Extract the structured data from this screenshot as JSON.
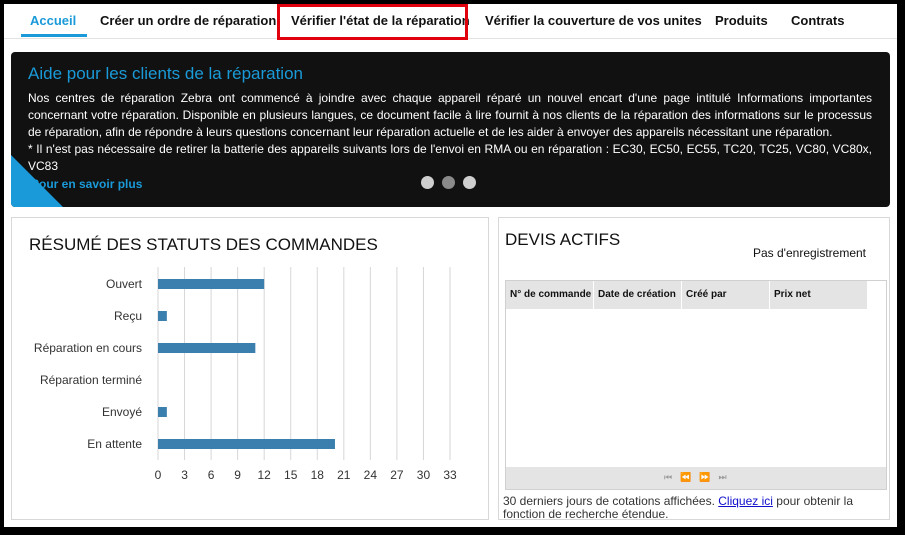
{
  "nav": {
    "items": [
      {
        "label": "Accueil",
        "active": true
      },
      {
        "label": "Créer un ordre de réparation",
        "active": false
      },
      {
        "label": "Vérifier l'état de la réparation",
        "active": false
      },
      {
        "label": "Vérifier la couverture de vos unites",
        "active": false
      },
      {
        "label": "Produits",
        "active": false
      },
      {
        "label": "Contrats",
        "active": false
      }
    ],
    "accent_color": "#1a9ad8",
    "highlight_color": "#e0000e"
  },
  "banner": {
    "title": "Aide pour les clients de la réparation",
    "paragraph1": "Nos centres de réparation Zebra ont commencé à joindre avec chaque appareil réparé un nouvel encart d'une page intitulé Informations importantes concernant votre réparation. Disponible en plusieurs langues, ce document facile à lire fournit à nos clients de la réparation des informations sur le processus de réparation, afin de répondre à leurs questions concernant leur réparation actuelle et de les aider à envoyer des appareils nécessitant une réparation.",
    "paragraph2": "* Il n'est pas nécessaire de retirer la batterie des appareils suivants lors de l'envoi en RMA ou en réparation : EC30, EC50, EC55, TC20, TC25, VC80, VC80x, VC83",
    "link": "Pour en savoir plus",
    "slides": 3,
    "active_slide": 2
  },
  "orders": {
    "title": "RÉSUMÉ DES STATUTS DES COMMANDES"
  },
  "chart_data": {
    "type": "bar",
    "orientation": "horizontal",
    "categories": [
      "Ouvert",
      "Reçu",
      "Réparation en cours",
      "Réparation terminé",
      "Envoyé",
      "En attente"
    ],
    "values": [
      12,
      1,
      11,
      0,
      1,
      20
    ],
    "xlim": [
      0,
      33
    ],
    "xticks": [
      0,
      3,
      6,
      9,
      12,
      15,
      18,
      21,
      24,
      27,
      30,
      33
    ],
    "grid": true,
    "bar_color": "#3a7fad"
  },
  "devis": {
    "title": "DEVIS ACTIFS",
    "no_record": "Pas d'enregistrement",
    "columns": [
      "N° de commande",
      "Date de création",
      "Créé par",
      "Prix net"
    ],
    "pager": [
      "first-page-icon",
      "prev-page-icon",
      "next-page-icon",
      "last-page-icon"
    ],
    "footnote_before": "30 derniers jours de cotations affichées.",
    "footnote_link": "Cliquez ici",
    "footnote_after": "pour obtenir la fonction de recherche étendue."
  }
}
